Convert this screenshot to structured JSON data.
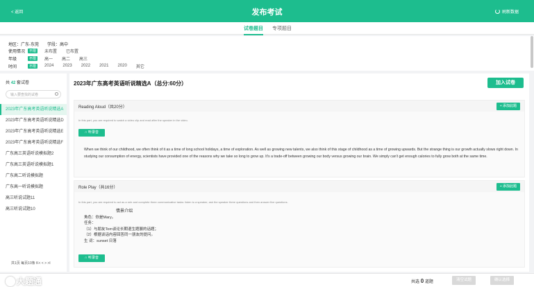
{
  "header": {
    "back": "< 返回",
    "title": "发布考试",
    "refresh": "刷新数据"
  },
  "tabs": [
    {
      "label": "试卷题目"
    },
    {
      "label": "专项题目"
    }
  ],
  "filters": {
    "region": {
      "label": "地区：",
      "value": "广东-东莞"
    },
    "stage": {
      "label": "学段：",
      "value": "高中"
    },
    "usage": {
      "label": "使用情况",
      "all": "不限",
      "options": [
        "未布置",
        "已布置"
      ]
    },
    "grade": {
      "label": "年级",
      "all": "不限",
      "options": [
        "高一",
        "高二",
        "高三"
      ]
    },
    "time": {
      "label": "时间",
      "all": "不限",
      "options": [
        "2024",
        "2023",
        "2022",
        "2021",
        "2020",
        "其它"
      ]
    }
  },
  "sidebar": {
    "count_prefix": "共",
    "count": "42",
    "count_suffix": "套试卷",
    "search_placeholder": "输入要查找的试卷",
    "items": [
      "2023年广东高考英语听说精选A",
      "2023年广东高考英语听说精选D",
      "2023年广东高考英语听说精选E",
      "2023年广东高考英语听说精选F",
      "广东高三英语听说模拟题2",
      "广东高三英语听说模拟题1",
      "广东高二听说模拟题",
      "广东高一听说模拟题",
      "高三听说试题11",
      "高三听说试题10"
    ],
    "pager": "共1页 每页10条 K< < > >I"
  },
  "main": {
    "paper_title": "2023年广东高考英语听说精选A（总分:60分）",
    "join_button": "加入试卷",
    "section1": {
      "title": "Reading Aloud（共20分）",
      "add": "+ 添加此题",
      "desc": "In this part, you are required to watch a video clip and read after the speaker in the video.",
      "listen": "听录音",
      "passage": "When we think of our childhood, we often think of it as a time of long school holidays, a time of exploration. As well as growing new talents, we also think of this stage of childhood as a time of growing upwards. But the strange thing is our growth actually slows right down. In studying our consumption of energy, scientists have provided one of the reasons why we take so long to grow up. It's a trade-off between growing our body versus growing our brain. We simply can't get enough calories to fully grow both at the same time."
    },
    "section2": {
      "title": "Role Play（共16分）",
      "add": "+ 添加此题",
      "desc": "In this part, you are required to act as a role and complete three communicative tasks: listen to a speaker, ask the speaker three questions and then answer five questions.",
      "info_title": "情景介绍",
      "role": "角色：你是Mary。",
      "task_label": "任务：",
      "task1": "（1）与朋友Tom谈论长期退生题展的话题；",
      "task2": "（2）根据谈话内容回答同一朋友的提问。",
      "words": "生 词：sunset 日落",
      "listen": "听录音"
    }
  },
  "footer": {
    "logo": "大题通",
    "selected_prefix": "共选",
    "selected_count": "0",
    "selected_suffix": "道题",
    "btn_clear": "清空试题",
    "btn_confirm": "确认选择"
  },
  "colors": {
    "accent": "#1dbd8e"
  }
}
